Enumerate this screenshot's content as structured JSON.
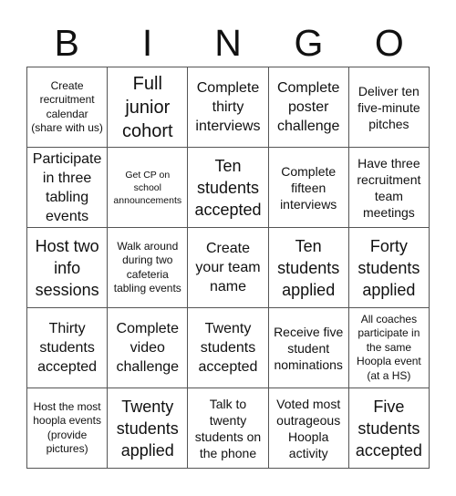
{
  "header": {
    "letters": [
      "B",
      "I",
      "N",
      "G",
      "O"
    ]
  },
  "cells": [
    [
      "Create recruitment calendar (share with us)",
      "Full junior cohort",
      "Complete thirty interviews",
      "Complete poster challenge",
      "Deliver ten five-minute pitches"
    ],
    [
      "Participate in three tabling events",
      "Get CP on school announcements",
      "Ten students accepted",
      "Complete fifteen interviews",
      "Have three recruitment team meetings"
    ],
    [
      "Host two info sessions",
      "Walk around during two cafeteria tabling events",
      "Create your team name",
      "Ten students applied",
      "Forty students applied"
    ],
    [
      "Thirty students accepted",
      "Complete video challenge",
      "Twenty students accepted",
      "Receive five student nominations",
      "All coaches participate in the same Hoopla event (at a HS)"
    ],
    [
      "Host the most hoopla events (provide pictures)",
      "Twenty students applied",
      "Talk to twenty students on the phone",
      "Voted most outrageous Hoopla activity",
      "Five students accepted"
    ]
  ]
}
